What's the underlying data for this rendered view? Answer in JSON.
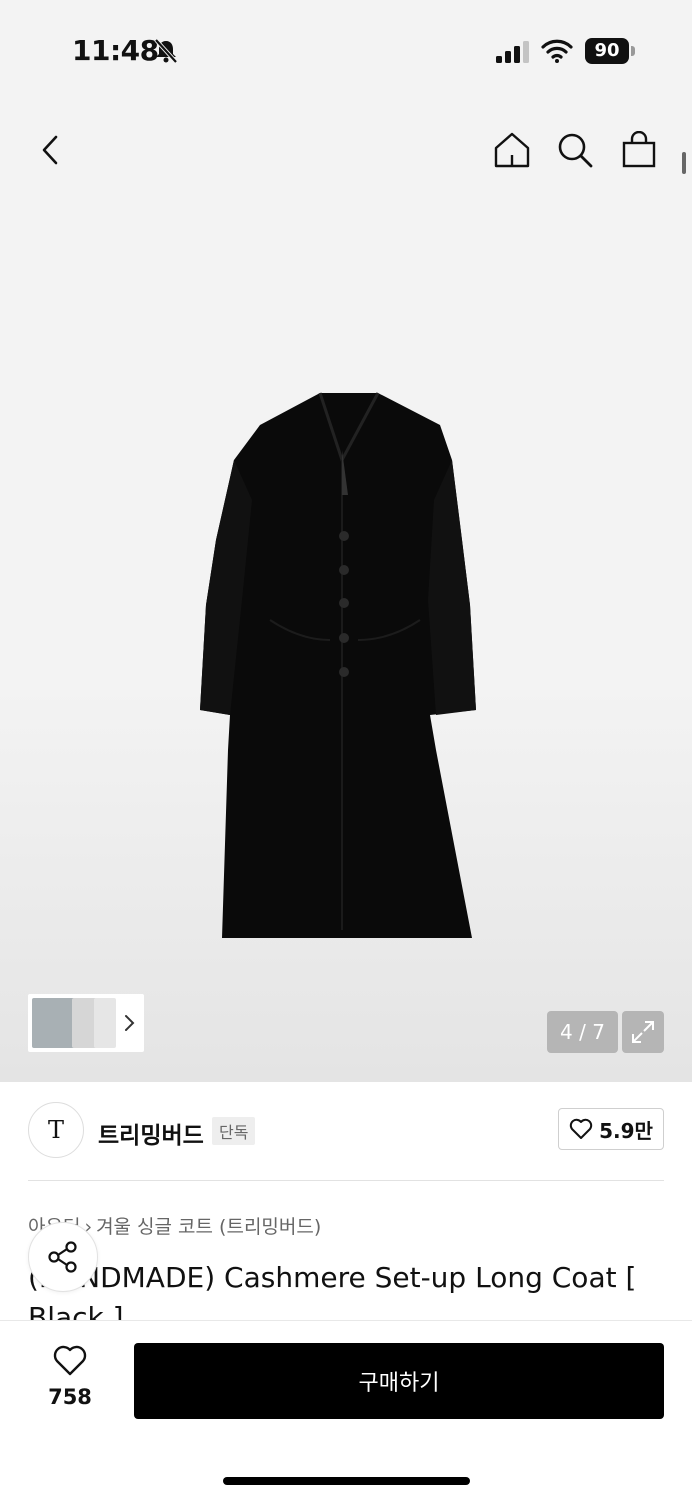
{
  "status_bar": {
    "time": "11:48",
    "battery": "90",
    "icons": [
      "bell-slash-icon",
      "cellular-signal-icon",
      "wifi-icon",
      "battery-icon"
    ]
  },
  "header": {
    "icons": [
      "chevron-left-icon",
      "home-icon",
      "search-icon",
      "shopping-bag-icon"
    ]
  },
  "gallery": {
    "counter": "4 / 7",
    "icons": [
      "chevron-right-icon",
      "expand-icon"
    ]
  },
  "brand": {
    "logo_text": "T",
    "name": "트리밍버드",
    "badge": "단독",
    "likes": "5.9만"
  },
  "breadcrumb": {
    "category": "아우터",
    "subcategory": "겨울 싱글 코트 (트리밍버드)"
  },
  "product": {
    "title": "(HANDMADE) Cashmere Set-up Long Coat [ Black ]"
  },
  "bottom_bar": {
    "wish_count": "758",
    "buy_label": "구매하기"
  },
  "colors": {
    "accent": "#000000",
    "background": "#f3f3f3",
    "counter_bg": "#b5b5b5"
  }
}
